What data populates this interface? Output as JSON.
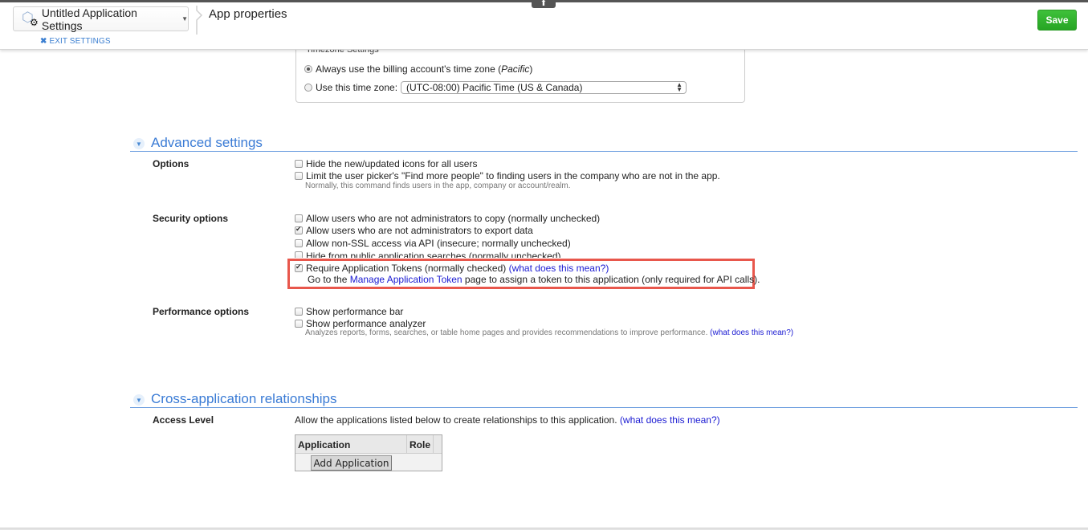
{
  "header": {
    "app_name": "Untitled Application Settings",
    "app_icon": "app-cube-gear-icon",
    "caret_icon": "chevron-down-icon",
    "page_title": "App properties",
    "exit_settings_label": "EXIT SETTINGS",
    "save_label": "Save",
    "collapse_icon": "arrow-up-icon",
    "colors": {
      "save": "#2eb32b",
      "accent": "#3a7bd5",
      "highlight": "#e8574c"
    }
  },
  "timezone": {
    "legend": "Timezone Settings",
    "options": [
      {
        "label": "Always use the billing account's time zone (",
        "italic": "Pacific",
        "after": ")",
        "selected": true
      },
      {
        "label": "Use this time zone:",
        "selected": false
      }
    ],
    "select_value": "(UTC-08:00) Pacific Time (US & Canada)"
  },
  "advanced": {
    "title": "Advanced settings",
    "options_label": "Options",
    "options": [
      {
        "label": "Hide the new/updated icons for all users",
        "checked": false
      },
      {
        "label": "Limit the user picker's \"Find more people\" to finding users in the company who are not in the app.",
        "checked": false
      }
    ],
    "options_hint": "Normally, this command finds users in the app, company or account/realm.",
    "security_label": "Security options",
    "security": [
      {
        "label": "Allow users who are not administrators to copy (normally unchecked)",
        "checked": false
      },
      {
        "label": "Allow users who are not administrators to export data",
        "checked": true
      },
      {
        "label": "Allow non-SSL access via API (insecure; normally unchecked)",
        "checked": false
      },
      {
        "label": "Hide from public application searches (normally unchecked)",
        "checked": false
      },
      {
        "label": "Require Application Tokens (normally checked)",
        "checked": true,
        "link": "(what does this mean?)"
      }
    ],
    "token_note": {
      "before": "Go to the ",
      "link": "Manage Application Token",
      "after": " page to assign a token to this application (only required for API calls)."
    },
    "performance_label": "Performance options",
    "performance": [
      {
        "label": "Show performance bar",
        "checked": false
      },
      {
        "label": "Show performance analyzer",
        "checked": false
      }
    ],
    "performance_hint": "Analyzes reports, forms, searches, or table home pages and provides recommendations to improve performance.",
    "performance_link": "(what does this mean?)"
  },
  "cross_app": {
    "title": "Cross-application relationships",
    "access_label": "Access Level",
    "access_text": "Allow the applications listed below to create relationships to this application.",
    "access_link": "(what does this mean?)",
    "table_headers": [
      "Application",
      "Role"
    ],
    "add_button": "Add Application"
  }
}
